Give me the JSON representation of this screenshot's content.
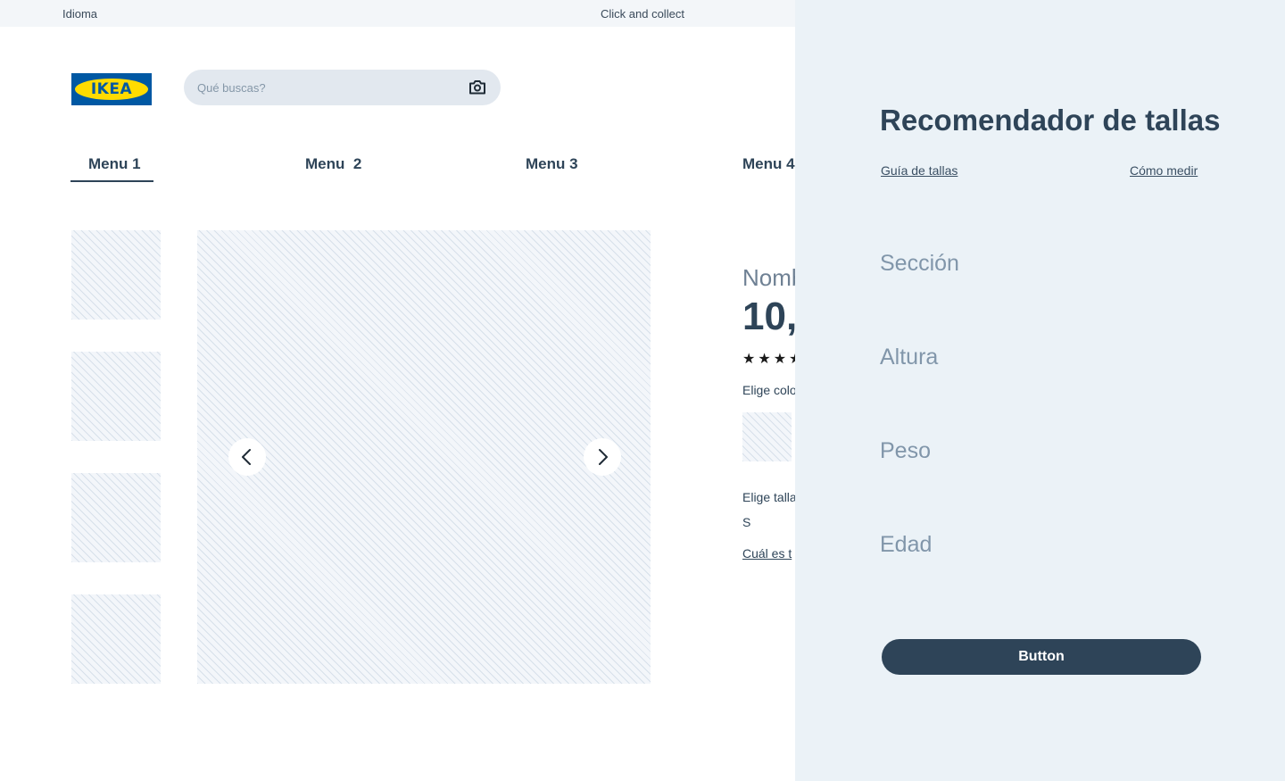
{
  "topbar": {
    "language": "Idioma",
    "click_collect": "Click and collect"
  },
  "brand": {
    "logo_text": "IKEA",
    "brand_blue": "#0058a3",
    "brand_yellow": "#ffdb00"
  },
  "search": {
    "placeholder": "Qué buscas?",
    "value": "",
    "icon": "camera-icon"
  },
  "menu": {
    "items": [
      {
        "label": "Menu 1",
        "active": true
      },
      {
        "label": "Menu  2",
        "active": false
      },
      {
        "label": "Menu 3",
        "active": false
      },
      {
        "label": "Menu 4",
        "active": false
      }
    ]
  },
  "gallery": {
    "prev_icon": "chevron-left-icon",
    "next_icon": "chevron-right-icon",
    "thumbnail_count": 4
  },
  "product": {
    "name": "Nomb",
    "price": "10,",
    "rating_stars": "★★★★",
    "color_label": "Elige colo",
    "size_label": "Elige talla",
    "size_value": "S",
    "size_link": "Cuál es t"
  },
  "panel": {
    "title": "Recomendador de tallas",
    "size_guide_link": "Guía de tallas",
    "how_to_measure_link": "Cómo medir",
    "fields": [
      "Sección",
      "Altura",
      "Peso",
      "Edad"
    ],
    "button_label": "Button",
    "background": "#ebf2f7",
    "accent": "#2e4458"
  }
}
